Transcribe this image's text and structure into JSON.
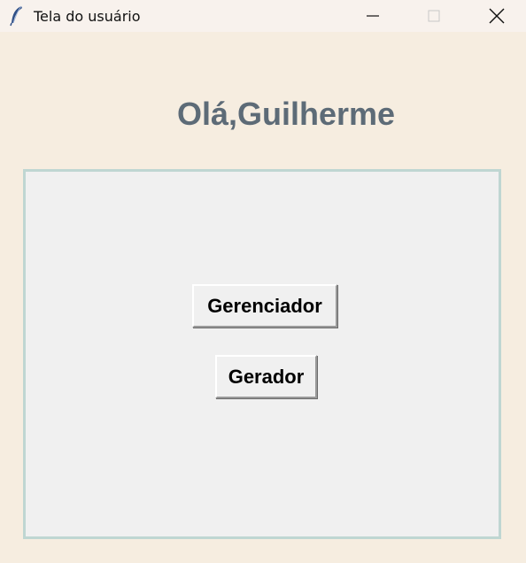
{
  "window": {
    "title": "Tela do usuário",
    "icon": "feather-icon"
  },
  "main": {
    "greeting": "Olá,Guilherme"
  },
  "buttons": {
    "gerenciador_label": "Gerenciador",
    "gerador_label": "Gerador"
  },
  "colors": {
    "background": "#f6ede0",
    "titlebar": "#f8f2ed",
    "panel": "#f0f0f0",
    "panel_border": "#bfd6d2",
    "greeting_text": "#5d6b77"
  }
}
